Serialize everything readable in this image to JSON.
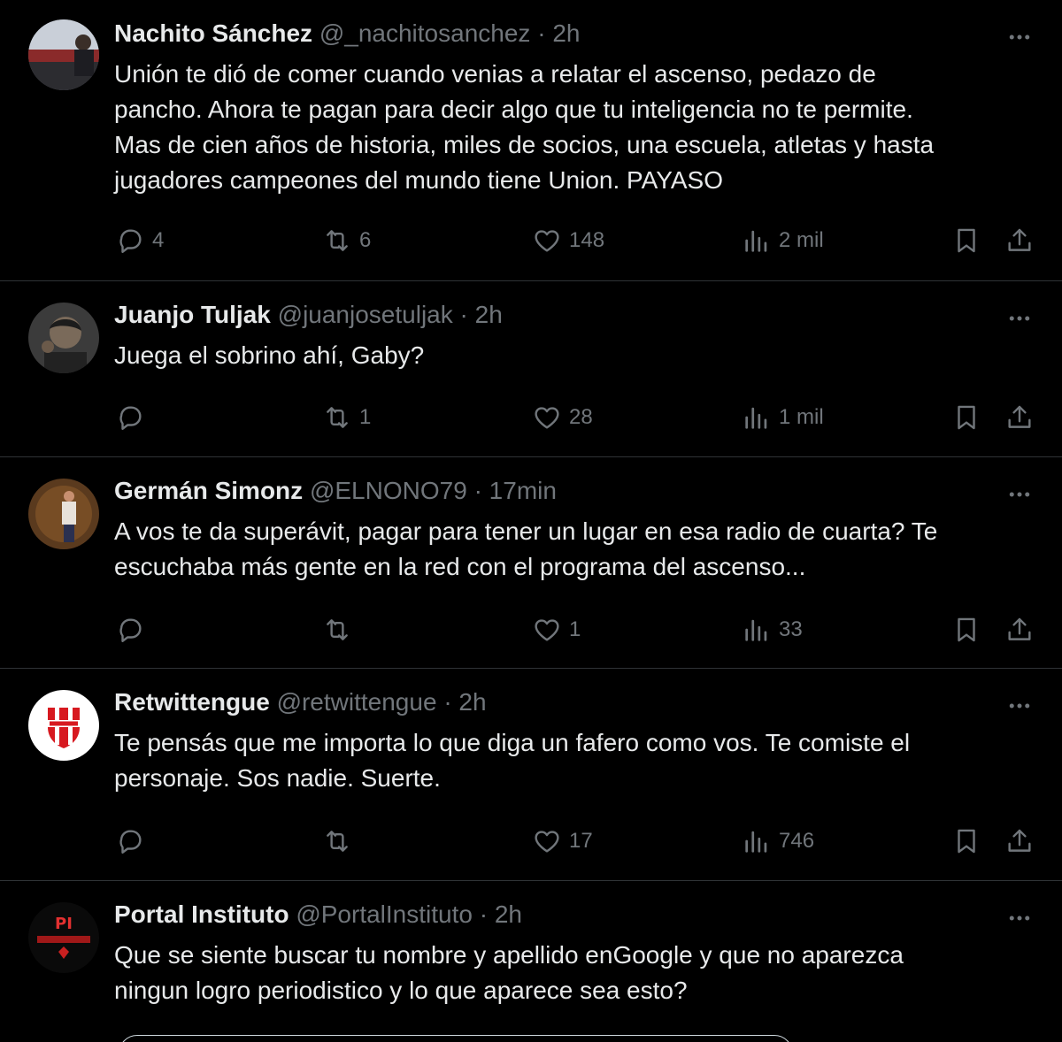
{
  "tweets": [
    {
      "name": "Nachito Sánchez",
      "handle": "@_nachitosanchez",
      "separator": "·",
      "time": "2h",
      "text_lines": [
        "Unión te dió de comer cuando venias a relatar el ascenso,  pedazo de",
        "pancho. Ahora te pagan para decir algo que tu inteligencia no te permite.",
        "Mas de cien años de historia,  miles de socios, una escuela, atletas y hasta",
        "jugadores campeones del mundo tiene Union.  PAYASO"
      ],
      "replies": "4",
      "retweets": "6",
      "likes": "148",
      "views": "2 mil"
    },
    {
      "name": "Juanjo Tuljak",
      "handle": "@juanjosetuljak",
      "separator": "·",
      "time": "2h",
      "text_lines": [
        "Juega el sobrino ahí, Gaby?"
      ],
      "replies": "",
      "retweets": "1",
      "likes": "28",
      "views": "1 mil"
    },
    {
      "name": "Germán Simonz",
      "handle": "@ELNONO79",
      "separator": "·",
      "time": "17min",
      "text_lines": [
        "A vos te da superávit, pagar para tener un lugar en esa radio de cuarta? Te",
        "escuchaba más gente en la red con el programa del ascenso..."
      ],
      "replies": "",
      "retweets": "",
      "likes": "1",
      "views": "33"
    },
    {
      "name": "Retwittengue",
      "handle": "@retwittengue",
      "separator": "·",
      "time": "2h",
      "text_lines": [
        "Te pensás que me importa lo que diga un fafero como vos. Te comiste el",
        "personaje. Sos nadie. Suerte."
      ],
      "replies": "",
      "retweets": "",
      "likes": "17",
      "views": "746"
    },
    {
      "name": "Portal Instituto",
      "handle": "@PortalInstituto",
      "separator": "·",
      "time": "2h",
      "text_lines": [
        "Que se siente buscar tu nombre y apellido enGoogle y que no aparezca",
        "ningun logro periodistico y lo que aparece sea esto?"
      ],
      "avatar_text": "PI"
    }
  ],
  "icons": {
    "more": "more-horizontal-icon",
    "reply": "reply-icon",
    "retweet": "retweet-icon",
    "like": "heart-icon",
    "views": "views-icon",
    "bookmark": "bookmark-icon",
    "share": "share-icon"
  },
  "colors": {
    "background": "#000000",
    "text": "#e7e9ea",
    "secondary": "#71767b",
    "divider": "#2f3336"
  }
}
